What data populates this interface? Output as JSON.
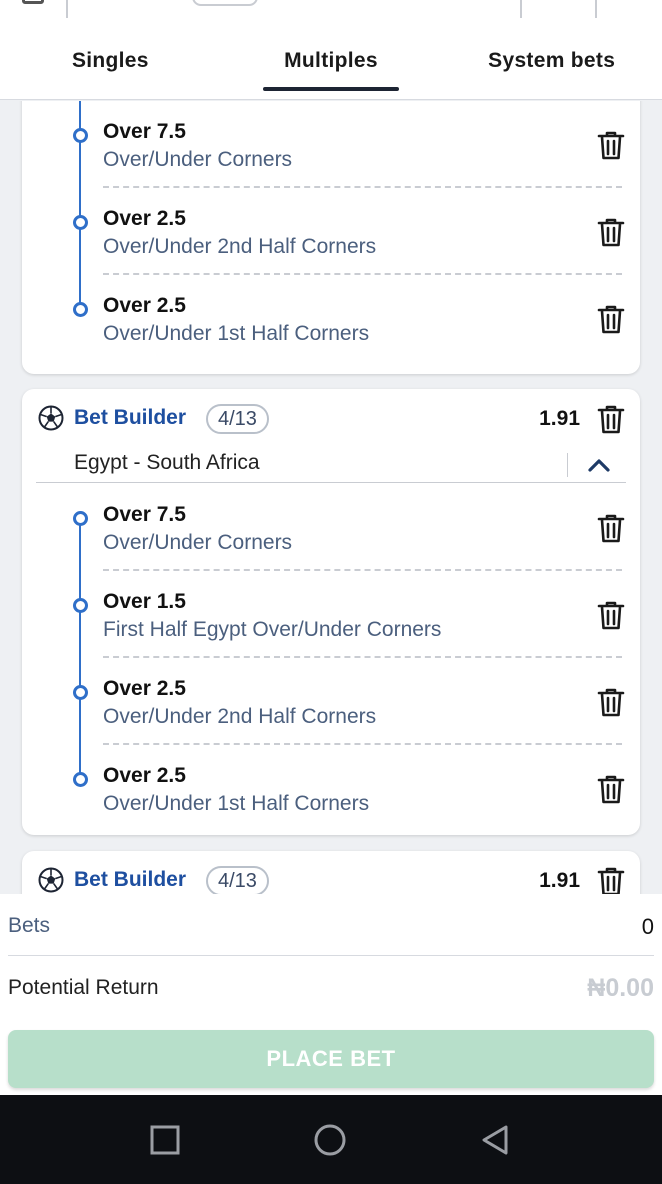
{
  "tabs": [
    {
      "label": "Singles",
      "active": false
    },
    {
      "label": "Multiples",
      "active": true
    },
    {
      "label": "System bets",
      "active": false
    }
  ],
  "cards": [
    {
      "legs": [
        {
          "selection": "Over 7.5",
          "market": "Over/Under Corners"
        },
        {
          "selection": "Over 2.5",
          "market": "Over/Under 2nd Half Corners"
        },
        {
          "selection": "Over 2.5",
          "market": "Over/Under 1st Half Corners"
        }
      ]
    },
    {
      "label": "Bet Builder",
      "count": "4/13",
      "odds": "1.91",
      "match": "Egypt - South Africa",
      "legs": [
        {
          "selection": "Over 7.5",
          "market": "Over/Under Corners"
        },
        {
          "selection": "Over 1.5",
          "market": "First Half Egypt Over/Under Corners"
        },
        {
          "selection": "Over 2.5",
          "market": "Over/Under 2nd Half Corners"
        },
        {
          "selection": "Over 2.5",
          "market": "Over/Under 1st Half Corners"
        }
      ]
    },
    {
      "label": "Bet Builder",
      "count": "4/13",
      "odds": "1.91"
    }
  ],
  "summary": {
    "bets_label": "Bets",
    "bets_value": "0",
    "return_label": "Potential Return",
    "return_value": "₦0.00",
    "place_bet": "PLACE BET"
  },
  "colors": {
    "accent": "#1e4fa0",
    "leg_line": "#2f6fc9",
    "place_bet_bg": "#b7dfca"
  }
}
